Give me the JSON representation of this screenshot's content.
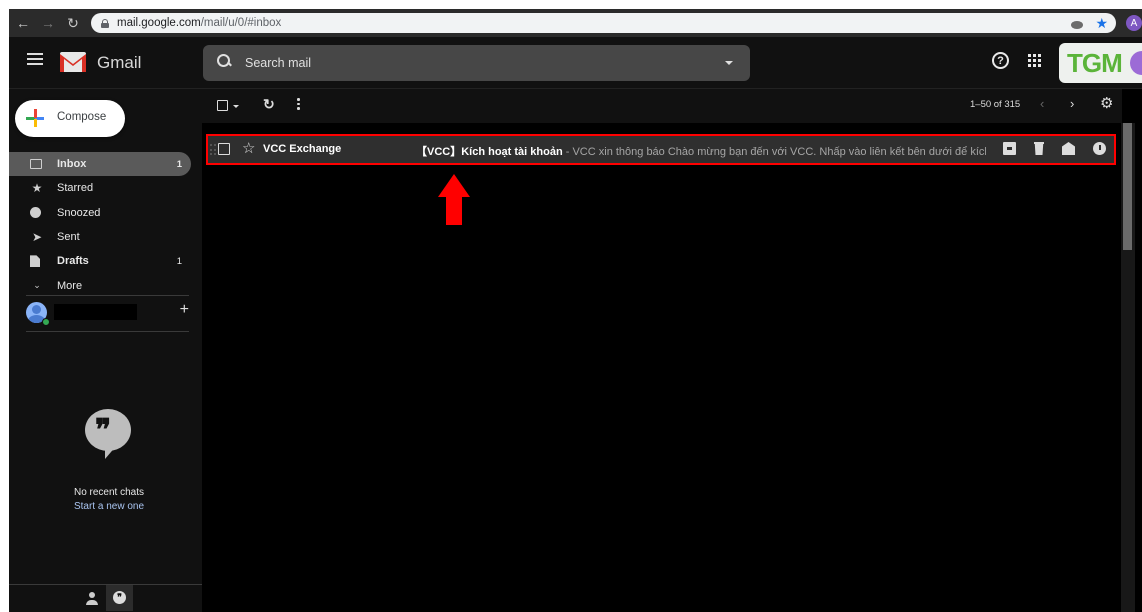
{
  "browser": {
    "url_host": "mail.google.com",
    "url_path": "/mail/u/0/#inbox",
    "profile_initial": "A"
  },
  "header": {
    "app_name": "Gmail",
    "search_placeholder": "Search mail",
    "help_glyph": "?",
    "brand_badge": "TGM"
  },
  "sidebar": {
    "compose_label": "Compose",
    "items": [
      {
        "label": "Inbox",
        "count": "1",
        "icon": "inbox-icon",
        "active": true,
        "bold": true
      },
      {
        "label": "Starred",
        "count": "",
        "icon": "star-icon",
        "active": false,
        "bold": false
      },
      {
        "label": "Snoozed",
        "count": "",
        "icon": "clock-icon",
        "active": false,
        "bold": false
      },
      {
        "label": "Sent",
        "count": "",
        "icon": "send-icon",
        "active": false,
        "bold": false
      },
      {
        "label": "Drafts",
        "count": "1",
        "icon": "draft-icon",
        "active": false,
        "bold": true
      },
      {
        "label": "More",
        "count": "",
        "icon": "chevron-down-icon",
        "active": false,
        "bold": false
      }
    ],
    "add_glyph": "+",
    "chat": {
      "empty_title": "No recent chats",
      "start_link": "Start a new one"
    }
  },
  "toolbar": {
    "pagination": "1–50 of 315",
    "prev_glyph": "‹",
    "next_glyph": "›"
  },
  "emails": [
    {
      "sender": "VCC Exchange",
      "subject": "【VCC】Kích hoạt tài khoản",
      "snippet": " - VCC xin thông báo Chào mừng bạn đến với VCC. Nhấp vào liên kết bên dưới để kích ho…",
      "highlighted": true
    }
  ],
  "colors": {
    "highlight": "#ff0000",
    "brand_green": "#5bb43a",
    "accent_blue": "#1a73e8"
  }
}
